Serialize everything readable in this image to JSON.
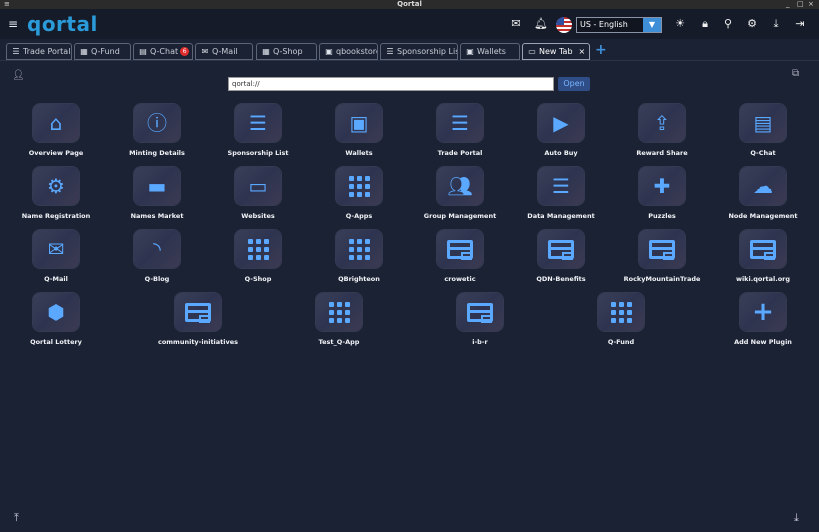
{
  "window": {
    "title": "Qortal",
    "menu_glyph": "≡",
    "min": "_",
    "max": "□",
    "close": "×"
  },
  "appbar": {
    "logo": "qortal",
    "language": "US - English"
  },
  "tabs": [
    {
      "label": "Trade Portal",
      "icon": "☰"
    },
    {
      "label": "Q-Fund",
      "icon": "▦"
    },
    {
      "label": "Q-Chat",
      "icon": "▤",
      "badge": "6"
    },
    {
      "label": "Q-Mail",
      "icon": "✉"
    },
    {
      "label": "Q-Shop",
      "icon": "▦"
    },
    {
      "label": "qbookstore",
      "icon": "▣"
    },
    {
      "label": "Sponsorship List",
      "icon": "☰"
    },
    {
      "label": "Wallets",
      "icon": "▣"
    },
    {
      "label": "New Tab",
      "icon": "▭",
      "close": "×"
    }
  ],
  "add_tab": "+",
  "url": {
    "value": "qortal://",
    "open_label": "Open"
  },
  "apps": [
    {
      "label": "Overview Page",
      "icon": "home-icon"
    },
    {
      "label": "Minting Details",
      "icon": "info-icon"
    },
    {
      "label": "Sponsorship List",
      "icon": "numbered-list-icon"
    },
    {
      "label": "Wallets",
      "icon": "wallet-icon"
    },
    {
      "label": "Trade Portal",
      "icon": "list-icon"
    },
    {
      "label": "Auto Buy",
      "icon": "shop-icon"
    },
    {
      "label": "Reward Share",
      "icon": "share-icon"
    },
    {
      "label": "Q-Chat",
      "icon": "chat-icon"
    },
    {
      "label": "Name Registration",
      "icon": "user-gear-icon"
    },
    {
      "label": "Names Market",
      "icon": "store-icon"
    },
    {
      "label": "Websites",
      "icon": "monitor-icon"
    },
    {
      "label": "Q-Apps",
      "icon": "apps-grid-icon"
    },
    {
      "label": "Group Management",
      "icon": "group-icon"
    },
    {
      "label": "Data Management",
      "icon": "storage-icon"
    },
    {
      "label": "Puzzles",
      "icon": "puzzle-icon"
    },
    {
      "label": "Node Management",
      "icon": "cloud-icon"
    },
    {
      "label": "Q-Mail",
      "icon": "mail-icon"
    },
    {
      "label": "Q-Blog",
      "icon": "rss-icon"
    },
    {
      "label": "Q-Shop",
      "icon": "apps-grid-icon"
    },
    {
      "label": "QBrighteon",
      "icon": "apps-grid-icon"
    },
    {
      "label": "crowetic",
      "icon": "window-icon"
    },
    {
      "label": "QDN-Benefits",
      "icon": "window-icon"
    },
    {
      "label": "RockyMountainTrade",
      "icon": "window-icon"
    },
    {
      "label": "wiki.qortal.org",
      "icon": "window-icon"
    },
    {
      "label": "Qortal Lottery",
      "icon": "cube-icon"
    },
    {
      "label": "community-initiatives",
      "icon": "window-icon"
    },
    {
      "label": "Test_Q-App",
      "icon": "apps-grid-icon"
    },
    {
      "label": "i-b-r",
      "icon": "window-icon"
    },
    {
      "label": "Q-Fund",
      "icon": "apps-grid-icon"
    },
    {
      "label": "Add New Plugin",
      "icon": "plus-icon"
    }
  ],
  "colors": {
    "background": "#1b2233",
    "accent": "#5aa8ff",
    "logo": "#2a9bd8"
  }
}
